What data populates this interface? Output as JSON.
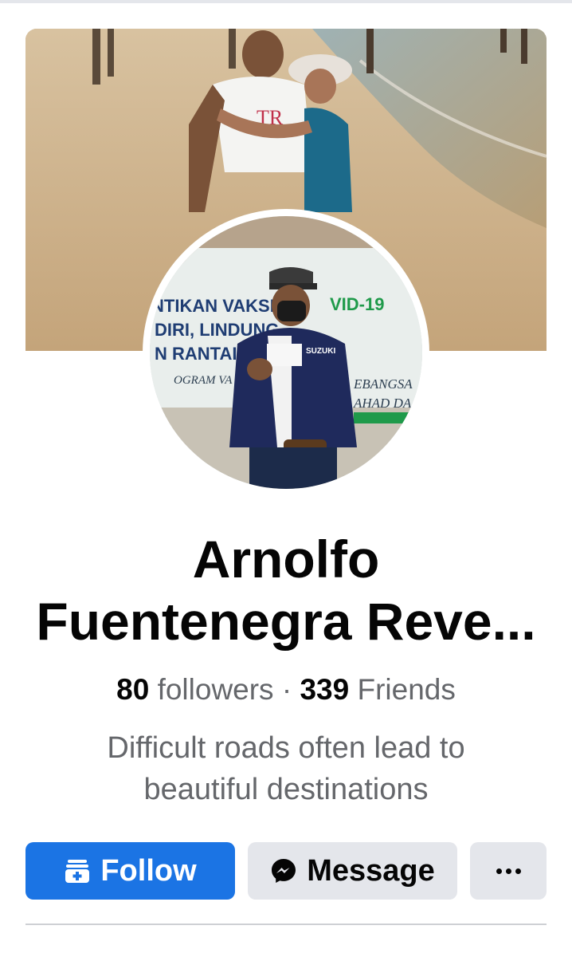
{
  "profile": {
    "name_line1": "Arnolfo",
    "name_line2": "Fuentenegra Reve...",
    "followers_count": "80",
    "followers_label": "followers",
    "separator": "·",
    "friends_count": "339",
    "friends_label": "Friends",
    "bio_line1": "Difficult roads often lead to",
    "bio_line2": "beautiful destinations"
  },
  "avatar_photo": {
    "banner_line1": "NTIKAN VAKSIN",
    "banner_line2": "DIRI, LINDUNG",
    "banner_line3": "N RANTAIAN",
    "banner_covid": "VID-19",
    "banner_lower_left": "OGRAM VA",
    "banner_lower_right1": "EBANGSA",
    "banner_lower_right2": "AHAD DA",
    "jacket_brand": "SUZUKI"
  },
  "cover_photo": {
    "shirt_text": "TR"
  },
  "actions": {
    "follow_label": "Follow",
    "message_label": "Message"
  },
  "icons": {
    "follow": "add-follow-icon",
    "message": "messenger-icon",
    "more": "more-options-icon"
  },
  "colors": {
    "primary": "#1b74e4",
    "secondary_button": "#e4e6eb",
    "text_primary": "#050505",
    "text_secondary": "#65676b"
  }
}
